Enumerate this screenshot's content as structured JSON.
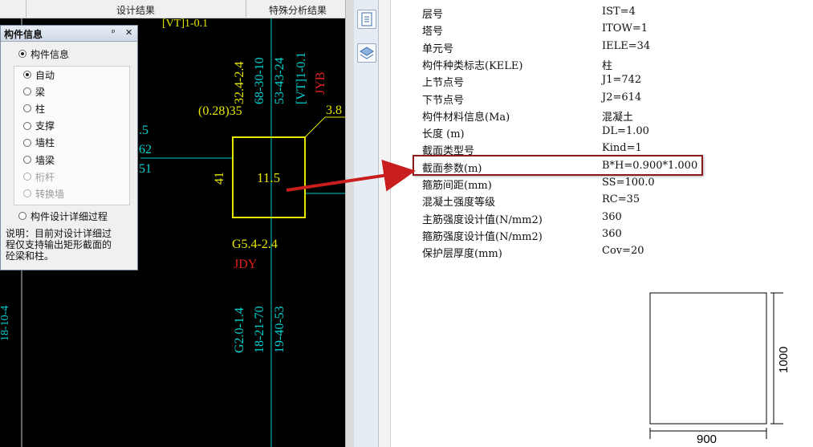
{
  "cad": {
    "tabs": [
      "设计结果",
      "特殊分析结果"
    ],
    "labels": {
      "top_partial": "[VT]1-0.1",
      "v1": "32.4-2.4",
      "v2": "68-30-10",
      "v3": "53-43-24",
      "v4": "[VT]1-0.1",
      "jyb": "JYB",
      "ratio": "(0.28)35",
      "corner": "3.8",
      "left1": ".5",
      "left2": "62",
      "left3": "51",
      "side41": "41",
      "center": "11.5",
      "g54": "G5.4-2.4",
      "jdy": "JDY",
      "g20": "G2.0-1.4",
      "b1": "18-21-70",
      "b2": "19-40-53",
      "edge": "18-10-4"
    }
  },
  "panel": {
    "title": "构件信息",
    "pin": "ᵖ",
    "close": "✕",
    "top_option": "构件信息",
    "options": [
      {
        "label": "自动",
        "selected": true,
        "disabled": false
      },
      {
        "label": "梁",
        "selected": false,
        "disabled": false
      },
      {
        "label": "柱",
        "selected": false,
        "disabled": false
      },
      {
        "label": "支撑",
        "selected": false,
        "disabled": false
      },
      {
        "label": "墙柱",
        "selected": false,
        "disabled": false
      },
      {
        "label": "墙梁",
        "selected": false,
        "disabled": false
      },
      {
        "label": "桁杆",
        "selected": false,
        "disabled": true
      },
      {
        "label": "转换墙",
        "selected": false,
        "disabled": true
      }
    ],
    "detail_option": "构件设计详细过程",
    "note_lines": [
      "说明：目前对设计详细过",
      "程仅支持输出矩形截面的",
      "砼梁和柱。"
    ]
  },
  "info": {
    "rows": [
      {
        "k": "层号",
        "v": "IST=4"
      },
      {
        "k": "塔号",
        "v": "ITOW=1"
      },
      {
        "k": "单元号",
        "v": "IELE=34"
      },
      {
        "k": "构件种类标志(KELE)",
        "v": "柱"
      },
      {
        "k": "上节点号",
        "v": "J1=742"
      },
      {
        "k": "下节点号",
        "v": "J2=614"
      },
      {
        "k": "构件材料信息(Ma)",
        "v": "混凝土"
      },
      {
        "k": "长度 (m)",
        "v": "DL=1.00"
      },
      {
        "k": "截面类型号",
        "v": "Kind=1"
      },
      {
        "k": "截面参数(m)",
        "v": "B*H=0.900*1.000"
      },
      {
        "k": "箍筋间距(mm)",
        "v": "SS=100.0"
      },
      {
        "k": "混凝土强度等级",
        "v": "RC=35"
      },
      {
        "k": "主筋强度设计值(N/mm2)",
        "v": "360"
      },
      {
        "k": "箍筋强度设计值(N/mm2)",
        "v": "360"
      },
      {
        "k": "保护层厚度(mm)",
        "v": "Cov=20"
      }
    ]
  },
  "section": {
    "width_label": "900",
    "height_label": "1000"
  },
  "colors": {
    "yellow": "#e6e600",
    "cyan": "#00e0e0",
    "red": "#e02020",
    "arrow": "#c81e1e"
  }
}
